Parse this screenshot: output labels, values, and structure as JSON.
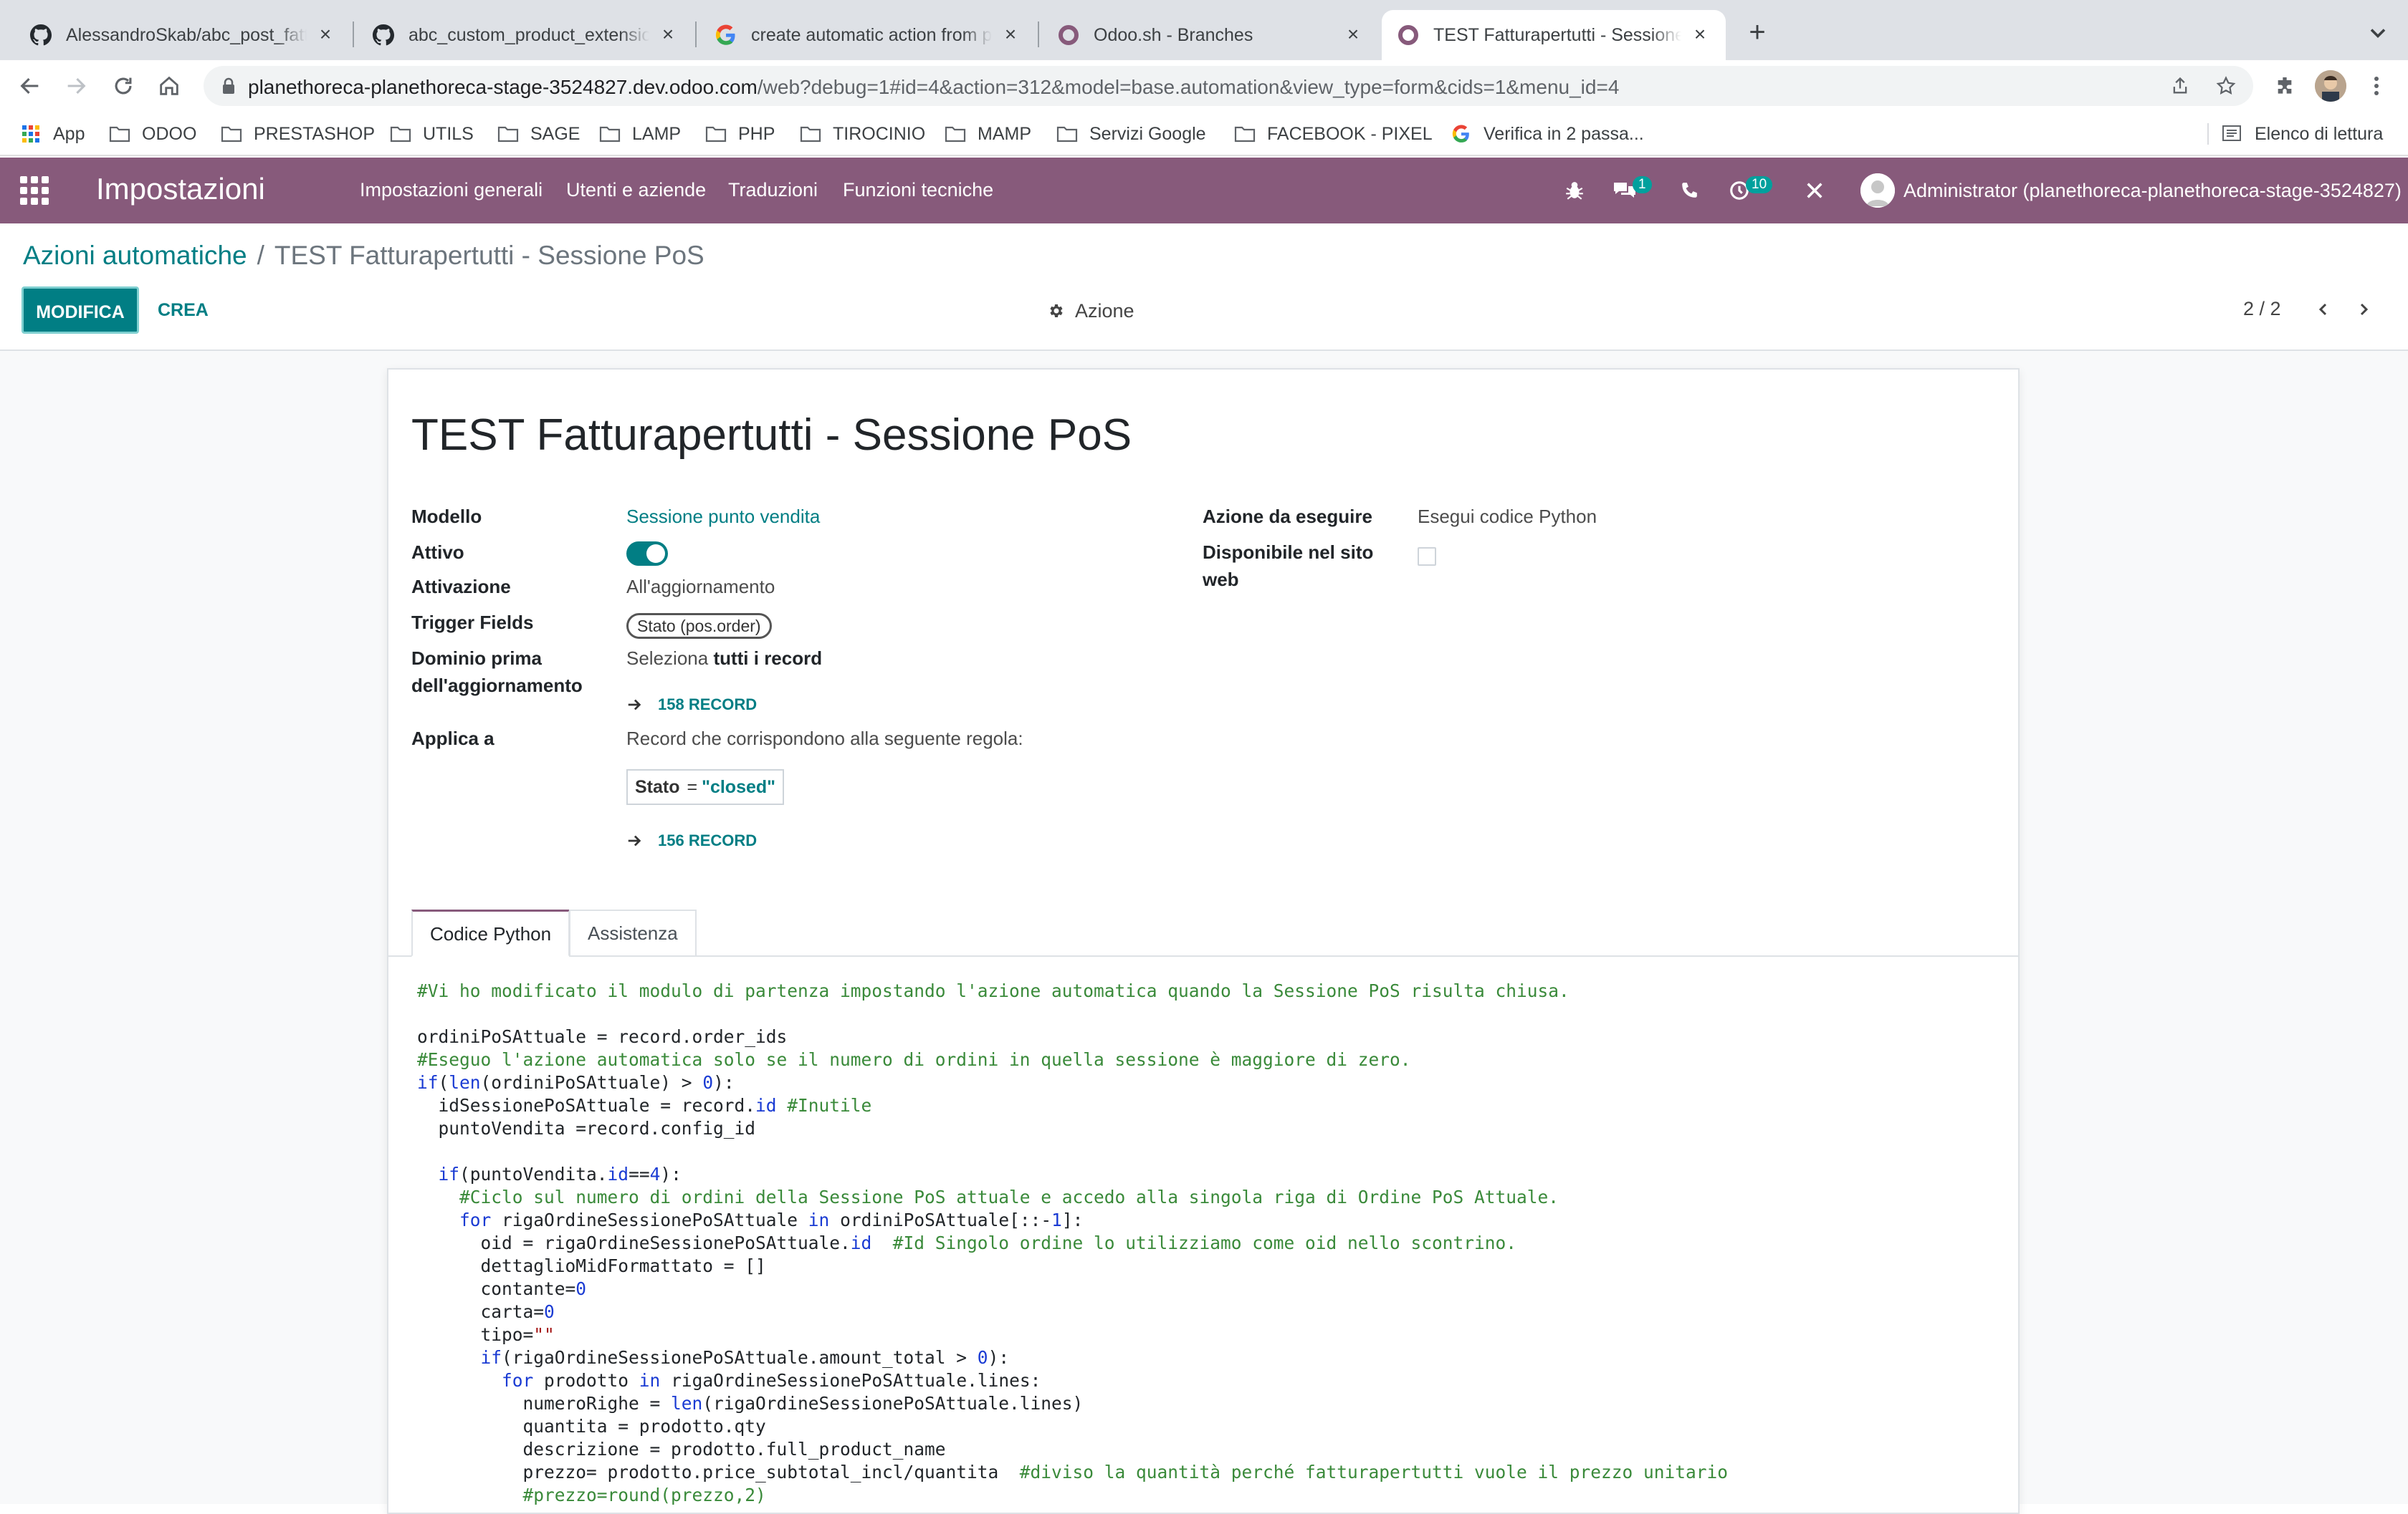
{
  "browser": {
    "tabs": [
      {
        "title": "AlessandroSkab/abc_post_fatt",
        "icon": "github-icon",
        "active": false
      },
      {
        "title": "abc_custom_product_extensio",
        "icon": "github-icon",
        "active": false
      },
      {
        "title": "create automatic action from p",
        "icon": "google-icon",
        "active": false
      },
      {
        "title": "Odoo.sh - Branches",
        "icon": "odoo-icon",
        "active": false
      },
      {
        "title": "TEST Fatturapertutti - Sessione",
        "icon": "odoo-icon",
        "active": true
      }
    ],
    "url_host": "planethoreca-planethoreca-stage-3524827.dev.odoo.com",
    "url_path": "/web?debug=1#id=4&action=312&model=base.automation&view_type=form&cids=1&menu_id=4",
    "bookmarks": [
      {
        "label": "App",
        "icon": "apps-grid-icon"
      },
      {
        "label": "ODOO",
        "icon": "folder-icon"
      },
      {
        "label": "PRESTASHOP",
        "icon": "folder-icon"
      },
      {
        "label": "UTILS",
        "icon": "folder-icon"
      },
      {
        "label": "SAGE",
        "icon": "folder-icon"
      },
      {
        "label": "LAMP",
        "icon": "folder-icon"
      },
      {
        "label": "PHP",
        "icon": "folder-icon"
      },
      {
        "label": "TIROCINIO",
        "icon": "folder-icon"
      },
      {
        "label": "MAMP",
        "icon": "folder-icon"
      },
      {
        "label": "Servizi Google",
        "icon": "folder-icon"
      },
      {
        "label": "FACEBOOK - PIXEL",
        "icon": "folder-icon"
      },
      {
        "label": "Verifica in 2 passa...",
        "icon": "google-icon"
      }
    ],
    "reading_list": "Elenco di lettura"
  },
  "navbar": {
    "app_title": "Impostazioni",
    "menus": [
      "Impostazioni generali",
      "Utenti e aziende",
      "Traduzioni",
      "Funzioni tecniche"
    ],
    "messages_badge": "1",
    "activities_badge": "10",
    "user": "Administrator (planethoreca-planethoreca-stage-3524827)",
    "color": "#875a7b"
  },
  "control_panel": {
    "breadcrumb_parent": "Azioni automatiche",
    "breadcrumb_sep": "/",
    "breadcrumb_current": "TEST Fatturapertutti - Sessione PoS",
    "edit_label": "MODIFICA",
    "create_label": "CREA",
    "action_label": "Azione",
    "pager": "2 / 2"
  },
  "form": {
    "title": "TEST Fatturapertutti - Sessione PoS",
    "model_label": "Modello",
    "model_value": "Sessione punto vendita",
    "active_label": "Attivo",
    "active_value": true,
    "trigger_label": "Attivazione",
    "trigger_value": "All'aggiornamento",
    "trigger_fields_label": "Trigger Fields",
    "trigger_fields_tag": "Stato (pos.order)",
    "pre_domain_label_1": "Dominio prima",
    "pre_domain_label_2": "dell'aggiornamento",
    "pre_domain_prefix": "Seleziona",
    "pre_domain_bold": "tutti i record",
    "pre_domain_records": "158 RECORD",
    "apply_label": "Applica a",
    "apply_value": "Record che corrispondono alla seguente regola:",
    "rule_field": "Stato",
    "rule_operator": "=",
    "rule_value": "\"closed\"",
    "apply_records": "156 RECORD",
    "action_to_do_label": "Azione da eseguire",
    "action_to_do_value": "Esegui codice Python",
    "website_label_1": "Disponibile nel sito",
    "website_label_2": "web",
    "website_value": false
  },
  "notebook": {
    "tabs": [
      "Codice Python",
      "Assistenza"
    ],
    "active": "Codice Python"
  },
  "code_lines": [
    "#Vi ho modificato il modulo di partenza impostando l'azione automatica quando la Sessione PoS risulta chiusa.",
    "",
    "ordiniPoSAttuale = record.order_ids",
    "#Eseguo l'azione automatica solo se il numero di ordini in quella sessione è maggiore di zero.",
    "if(len(ordiniPoSAttuale) > 0):",
    "  idSessionePoSAttuale = record.id #Inutile",
    "  puntoVendita =record.config_id",
    "",
    "  if(puntoVendita.id==4):",
    "    #Ciclo sul numero di ordini della Sessione PoS attuale e accedo alla singola riga di Ordine PoS Attuale.",
    "    for rigaOrdineSessionePoSAttuale in ordiniPoSAttuale[::-1]:",
    "      oid = rigaOrdineSessionePoSAttuale.id  #Id Singolo ordine lo utilizziamo come oid nello scontrino.",
    "      dettaglioMidFormattato = []",
    "      contante=0",
    "      carta=0",
    "      tipo=\"\"",
    "      if(rigaOrdineSessionePoSAttuale.amount_total > 0):",
    "        for prodotto in rigaOrdineSessionePoSAttuale.lines:",
    "          numeroRighe = len(rigaOrdineSessionePoSAttuale.lines)",
    "          quantita = prodotto.qty",
    "          descrizione = prodotto.full_product_name",
    "          prezzo= prodotto.price_subtotal_incl/quantita  #diviso la quantità perché fatturapertutti vuole il prezzo unitario",
    "          #prezzo=round(prezzo,2)"
  ]
}
